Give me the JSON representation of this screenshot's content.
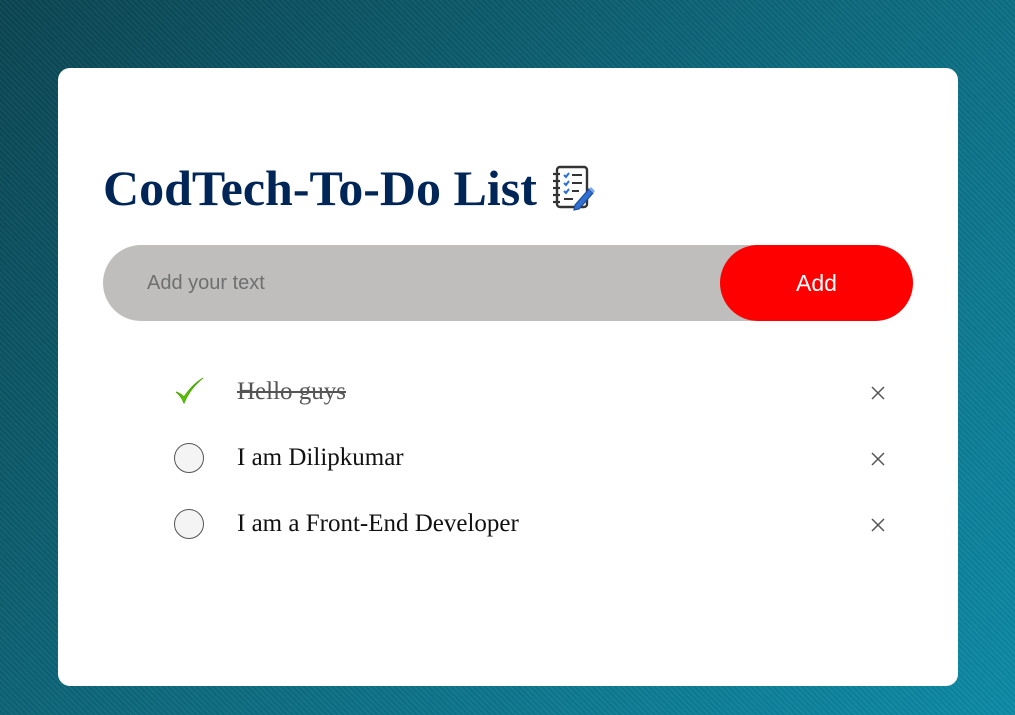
{
  "app": {
    "title": "CodTech-To-Do List",
    "title_icon": "notebook-checklist-icon"
  },
  "input": {
    "placeholder": "Add your text",
    "value": ""
  },
  "add_button": {
    "label": "Add"
  },
  "tasks": [
    {
      "text": "Hello guys",
      "completed": true
    },
    {
      "text": "I am Dilipkumar",
      "completed": false
    },
    {
      "text": "I am a Front-End Developer",
      "completed": false
    }
  ],
  "icons": {
    "checked": "checkmark-icon",
    "unchecked": "empty-circle-icon",
    "delete": "close-icon"
  },
  "colors": {
    "title": "#002657",
    "add_button": "#ff0000",
    "input_background": "#bfbebd",
    "checkmark": "#5cc400",
    "card": "#ffffff"
  }
}
